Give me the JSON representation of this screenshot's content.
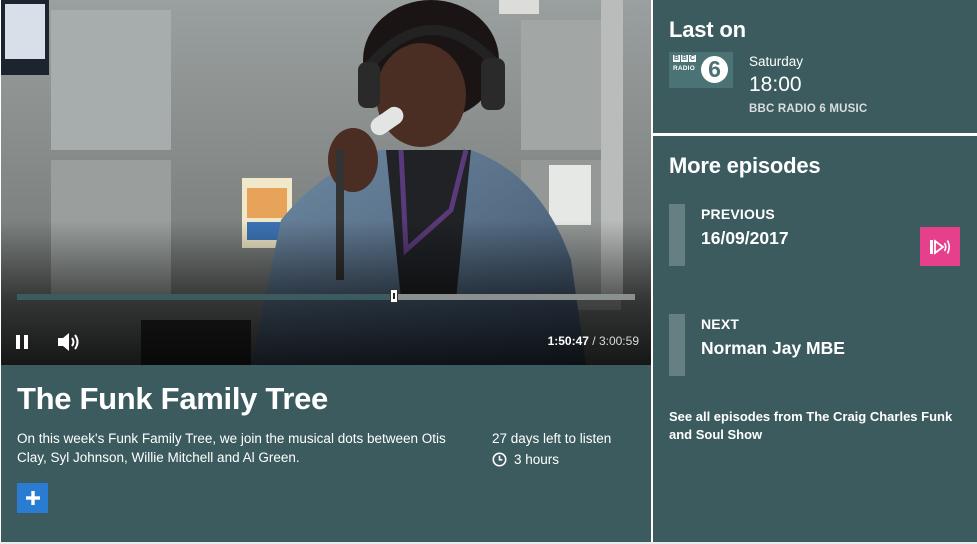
{
  "player": {
    "elapsed": "1:50:47",
    "total": "3:00:59",
    "progress": 0.61
  },
  "episode": {
    "title": "The Funk Family Tree",
    "description": "On this week's Funk Family Tree, we join the musical dots between Otis Clay, Syl Johnson, Willie Mitchell and Al Green.",
    "availability": "27 days left to listen",
    "duration": "3 hours"
  },
  "last_on": {
    "heading": "Last on",
    "day": "Saturday",
    "time": "18:00",
    "station": "BBC RADIO 6 MUSIC",
    "logo": {
      "bbc": [
        "B",
        "B",
        "C"
      ],
      "radio": "RADIO",
      "number": "6"
    }
  },
  "more_episodes": {
    "heading": "More episodes",
    "previous_label": "PREVIOUS",
    "previous_value": "16/09/2017",
    "next_label": "NEXT",
    "next_value": "Norman Jay MBE",
    "see_all": "See all episodes from The Craig Charles Funk and Soul Show"
  },
  "icons": {
    "pause": "pause-icon",
    "volume": "speaker-volume-icon",
    "clock": "clock-icon",
    "add": "plus-icon",
    "listen": "play-radio-icon"
  },
  "colors": {
    "panel": "#3c5b5e",
    "accent_pink": "#e63f8b",
    "add_blue": "#2a7bd2"
  }
}
